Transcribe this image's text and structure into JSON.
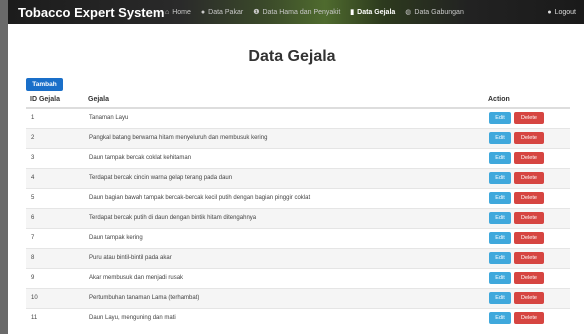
{
  "navbar": {
    "brand": "Tobacco Expert System",
    "items": [
      {
        "label": "Home",
        "icon": "home-icon",
        "glyph": "⌂",
        "active": false
      },
      {
        "label": "Data Pakar",
        "icon": "user-icon",
        "glyph": "●",
        "active": false
      },
      {
        "label": "Data Hama dan Penyakit",
        "icon": "info-icon",
        "glyph": "❶",
        "active": false
      },
      {
        "label": "Data Gejala",
        "icon": "document-icon",
        "glyph": "▮",
        "active": true
      },
      {
        "label": "Data Gabungan",
        "icon": "globe-icon",
        "glyph": "◍",
        "active": false
      }
    ],
    "logout": "Logout"
  },
  "page": {
    "title": "Data Gejala",
    "add_button": "Tambah"
  },
  "table": {
    "headers": {
      "id": "ID Gejala",
      "gejala": "Gejala",
      "action": "Action"
    },
    "edit_label": "Edit",
    "delete_label": "Delete",
    "rows": [
      {
        "id": "1",
        "gejala": "Tanaman Layu"
      },
      {
        "id": "2",
        "gejala": "Pangkal batang berwarna hitam menyeluruh dan membusuk kering"
      },
      {
        "id": "3",
        "gejala": "Daun tampak bercak coklat kehitaman"
      },
      {
        "id": "4",
        "gejala": "Terdapat bercak cincin warna gelap terang pada daun"
      },
      {
        "id": "5",
        "gejala": "Daun bagian bawah tampak bercak-bercak kecil putih dengan bagian pinggir coklat"
      },
      {
        "id": "6",
        "gejala": "Terdapat bercak putih di daun dengan bintik hitam ditengahnya"
      },
      {
        "id": "7",
        "gejala": "Daun tampak kering"
      },
      {
        "id": "8",
        "gejala": "Puru atau bintil-bintil pada akar"
      },
      {
        "id": "9",
        "gejala": "Akar membusuk dan menjadi rusak"
      },
      {
        "id": "10",
        "gejala": "Pertumbuhan tanaman Lama (terhambat)"
      },
      {
        "id": "11",
        "gejala": "Daun Layu, menguning dan mati"
      }
    ]
  },
  "colors": {
    "primary": "#1a6fc9",
    "edit": "#3fa8dc",
    "delete": "#d64541",
    "brand_leaf": "#6fbf3a"
  }
}
